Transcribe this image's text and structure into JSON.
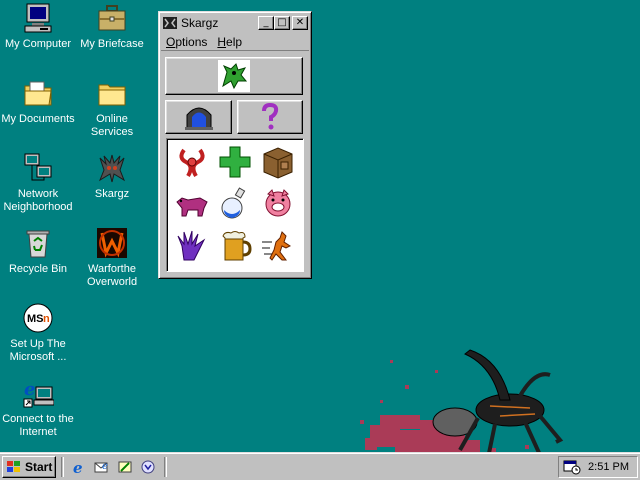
{
  "desktop": {
    "icons": [
      {
        "label": "My Computer"
      },
      {
        "label": "My Briefcase"
      },
      {
        "label": "My Documents"
      },
      {
        "label": "Online Services"
      },
      {
        "label": "Network Neighborhood"
      },
      {
        "label": "Skargz"
      },
      {
        "label": "Recycle Bin"
      },
      {
        "label": "Warforthe Overworld"
      },
      {
        "label": "Set Up The Microsoft ..."
      },
      {
        "label": "Connect to the Internet"
      }
    ],
    "background_color": "#008080"
  },
  "window": {
    "title": "Skargz",
    "menu": {
      "options": {
        "underline": "O",
        "rest": "ptions"
      },
      "help": {
        "underline": "H",
        "rest": "elp"
      }
    },
    "controls": {
      "minimize": "_",
      "maximize": "□",
      "close": "✕"
    },
    "buttons": [
      {
        "icon": "green-beast-icon"
      },
      {
        "icon": "blue-gate-icon"
      },
      {
        "icon": "question-mark-icon"
      }
    ],
    "grid_icons": [
      "red-ribbon-icon",
      "green-cross-icon",
      "wooden-crate-icon",
      "purple-beast-icon",
      "potion-flask-icon",
      "pink-pig-icon",
      "purple-claw-icon",
      "beer-mug-icon",
      "running-imp-icon"
    ]
  },
  "taskbar": {
    "start_label": "Start",
    "clock": "2:51 PM"
  }
}
